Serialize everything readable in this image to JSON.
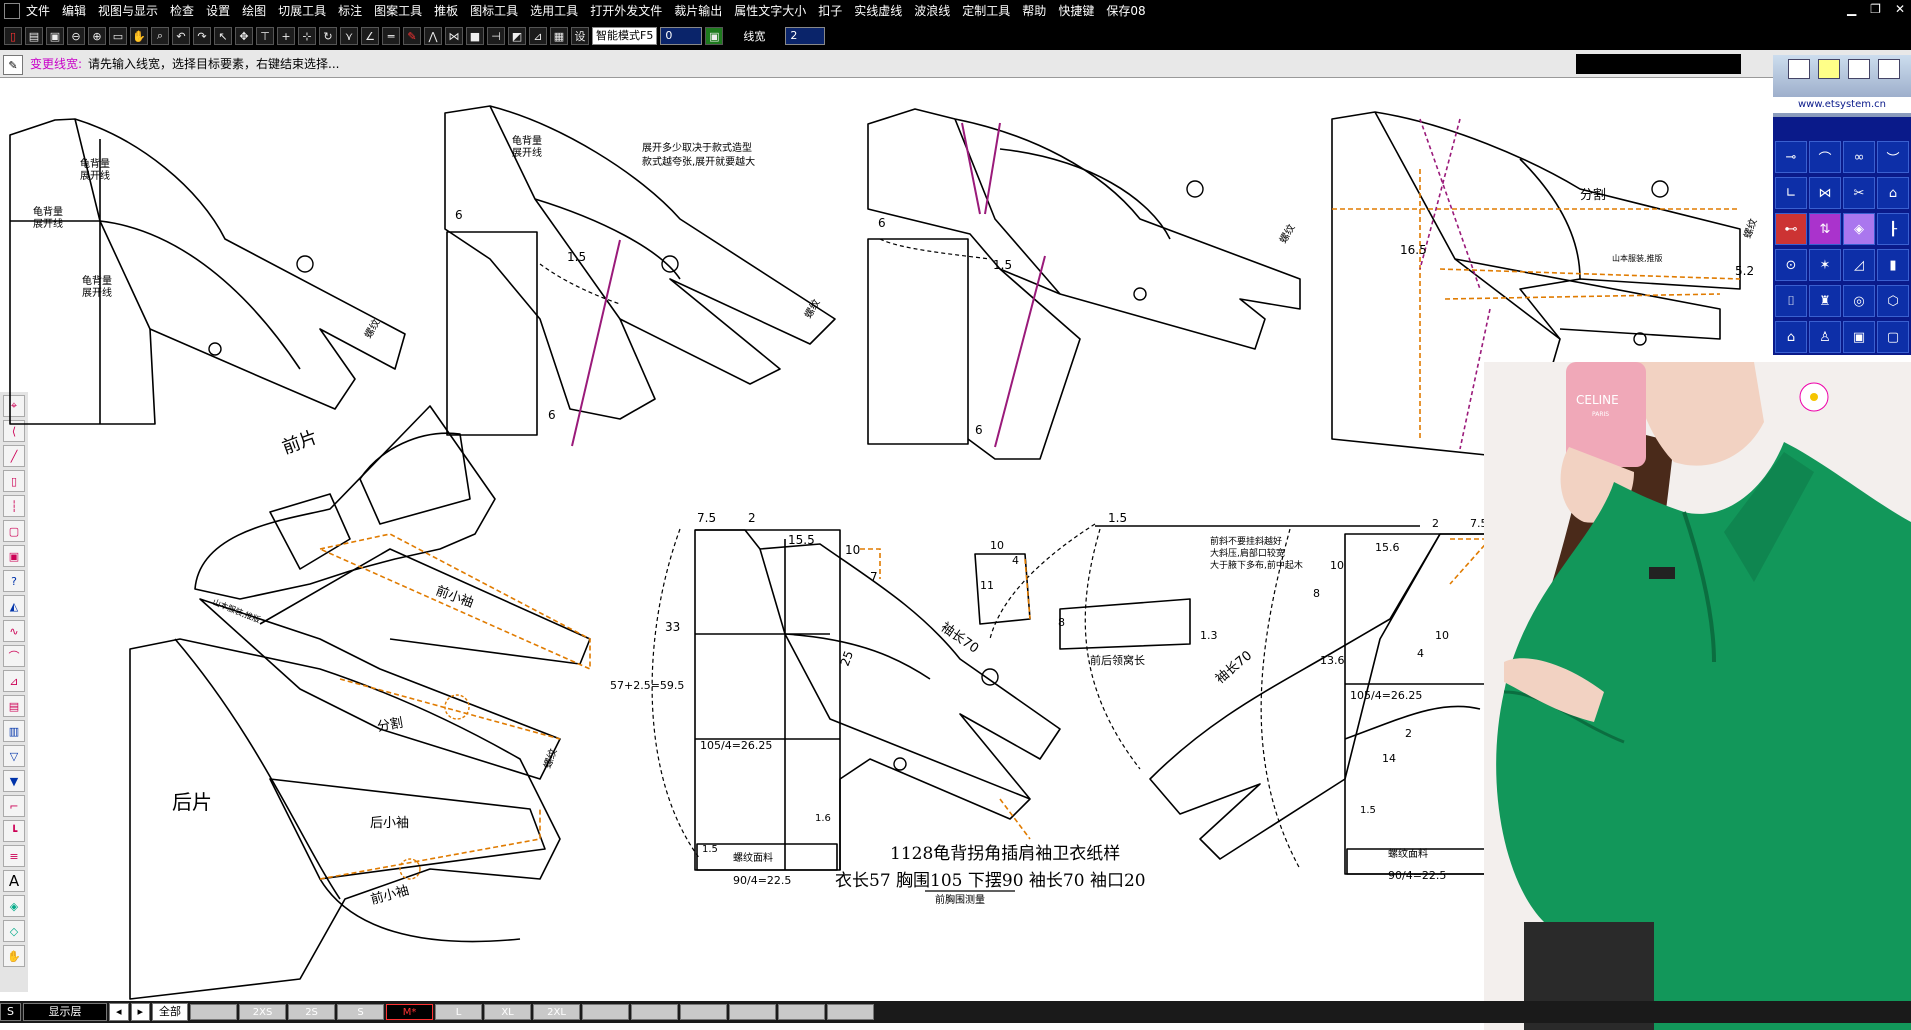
{
  "menu": [
    "文件",
    "编辑",
    "视图与显示",
    "检查",
    "设置",
    "绘图",
    "切展工具",
    "标注",
    "图案工具",
    "推板",
    "图标工具",
    "选用工具",
    "打开外发文件",
    "裁片输出",
    "属性文字大小",
    "扣子",
    "实线虚线",
    "波浪线",
    "定制工具",
    "帮助",
    "快捷键",
    "保存08"
  ],
  "toolbar": {
    "mode_select": "智能模式F5",
    "value_field": "0",
    "line_width_label": "线宽",
    "line_width_value": "2",
    "icon_glyph": "设"
  },
  "prompt": {
    "mode": "变更线宽:",
    "message": "请先输入线宽，选择目标要素，右键结束选择..."
  },
  "brand": "www.etsystem.cn",
  "sizebar": {
    "s_label": "S",
    "layer_label": "显示层",
    "all_label": "全部",
    "sizes": [
      "2XS",
      "2S",
      "S",
      "M*",
      "L",
      "XL",
      "2XL"
    ],
    "active": "M*"
  },
  "labels": {
    "piece1_a": "龟背量",
    "piece1_b": "展开线",
    "piece1_c": "龟背量",
    "piece1_d": "展开线",
    "piece1_e": "龟背量",
    "piece1_f": "展开线",
    "cuff": "螺纹",
    "piece2_a": "龟背量",
    "piece2_b": "展开线",
    "piece2_note1": "展开多少取决于款式造型",
    "piece2_note2": "款式越夸张,展开就要越大",
    "p2_6a": "6",
    "p2_15": "1.5",
    "p2_6b": "6",
    "p3_6a": "6",
    "p3_15": "1.5",
    "p3_6b": "6",
    "p4_fen": "分割",
    "p4_165": "16.5",
    "p4_52": "5.2",
    "p4_brand": "山本服装,推版",
    "qian_pian": "前片",
    "qian_xiao_xiu": "前小袖",
    "fen_ge": "分割",
    "hou_pian": "后片",
    "hou_xiao_xiu": "后小袖",
    "qian_xiao_xiu2": "前小袖",
    "brand_small": "山本服装,推版",
    "d_75a": "7.5",
    "d_2a": "2",
    "d_155": "15.5",
    "d_10a": "10",
    "d_7": "7",
    "d_33": "33",
    "d_57": "57+2.5=59.5",
    "d_105": "105/4=26.25",
    "d_25": "25",
    "d_xiuchang_l": "袖长70",
    "d_16": "1.6",
    "d_15": "1.5",
    "d_90": "90/4=22.5",
    "d_luowen": "螺纹面料",
    "d_10b": "10",
    "d_4": "4",
    "d_11": "11",
    "d_8a": "8",
    "d_13": "1.3",
    "d_lingkou": "前后领窝长",
    "d_top15": "1.5",
    "d_note1": "前斜不要挂斜越好",
    "d_note2": "大斜压,肩部口较宽",
    "d_note3": "大于腋下多布,前中起木",
    "d_10c": "10",
    "d_156": "15.6",
    "d_2b": "2",
    "d_75b": "7.5",
    "d_8b": "8",
    "d_xiuchang_r": "袖长70",
    "d_136": "13.6",
    "d_10d": "10",
    "d_4b": "4",
    "d_105b": "105/4=26.25",
    "d_14": "14",
    "d_2c": "2",
    "d_15b": "1.5",
    "d_90b": "90/4=22.5",
    "d_luowen_b": "螺纹面料"
  },
  "caption": {
    "title": "1128龟背拐角插肩袖卫衣纸样",
    "specs": "衣长57   胸围105   下摆90   袖长70   袖口20",
    "note": "前胸围测量"
  },
  "photo": {
    "phone_brand": "CELINE",
    "phone_sub": "PARIS"
  },
  "colors": {
    "accent_orange": "#e07b00",
    "accent_magenta": "#9a1a7a",
    "brand_blue": "#0a1a8a"
  }
}
